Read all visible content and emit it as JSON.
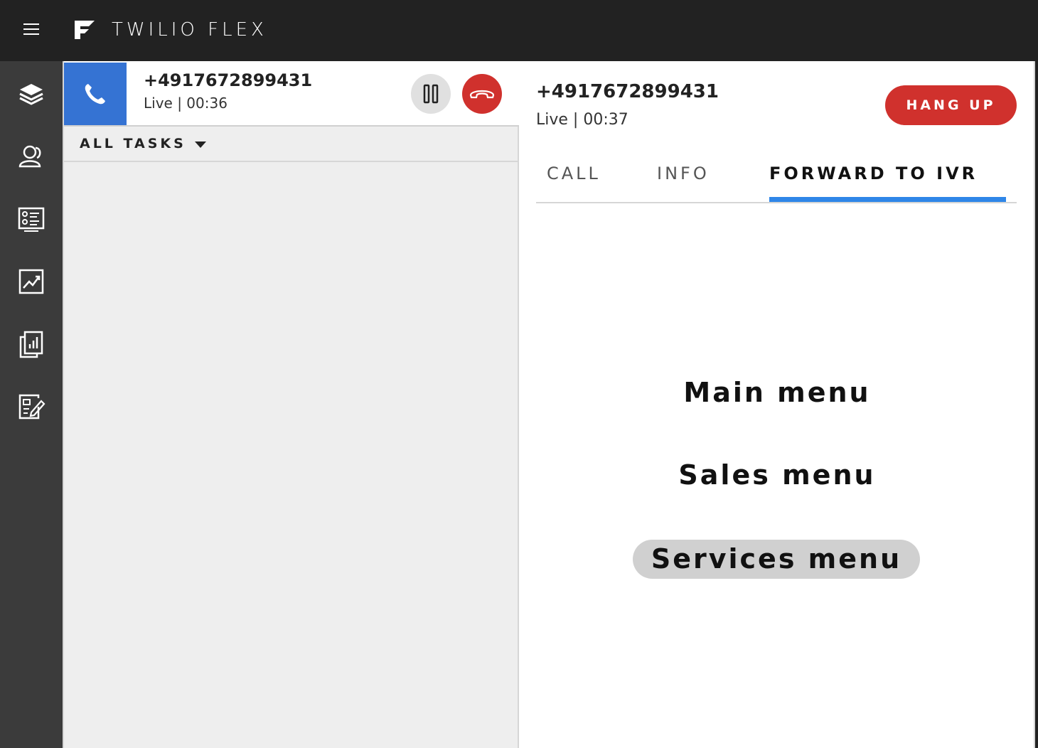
{
  "header": {
    "brand_name": "TWILIO FLEX"
  },
  "sidebar": {
    "items": [
      {
        "name": "layers-icon"
      },
      {
        "name": "contacts-icon"
      },
      {
        "name": "queues-icon"
      },
      {
        "name": "analytics-icon"
      },
      {
        "name": "reports-icon"
      },
      {
        "name": "edit-form-icon"
      }
    ]
  },
  "task_list": {
    "task": {
      "number": "+4917672899431",
      "status": "Live | 00:36"
    },
    "filter_label": "ALL TASKS"
  },
  "detail": {
    "number": "+4917672899431",
    "status": "Live | 00:37",
    "hangup_label": "HANG UP",
    "tabs": [
      {
        "label": "CALL",
        "active": false
      },
      {
        "label": "INFO",
        "active": false
      },
      {
        "label": "FORWARD TO IVR",
        "active": true
      }
    ],
    "menu_options": [
      {
        "label": "Main menu",
        "highlighted": false
      },
      {
        "label": "Sales menu",
        "highlighted": false
      },
      {
        "label": "Services menu",
        "highlighted": true
      }
    ]
  },
  "colors": {
    "topbar": "#222222",
    "sidebar": "#3b3b3b",
    "accent_blue": "#3573d3",
    "tab_underline": "#2f86e8",
    "danger_red": "#d0312d"
  }
}
